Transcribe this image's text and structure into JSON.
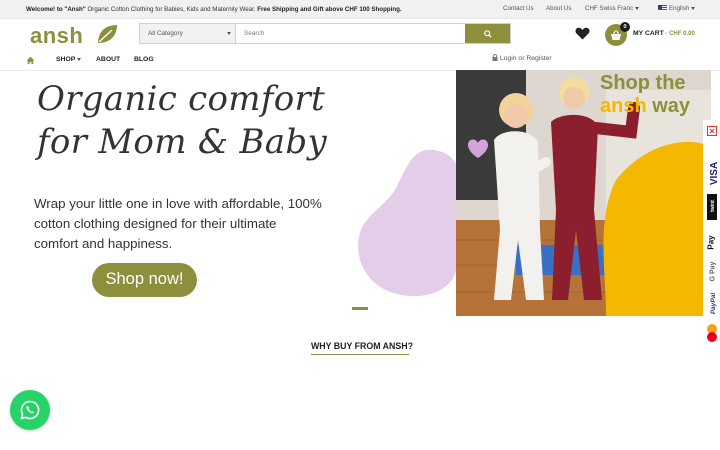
{
  "topbar": {
    "welcome_bold": "Welcome! to \"Ansh\"",
    "welcome_text": " Organic Cotton Clothing for Babies, Kids and Maternity Wear.",
    "shipping": " Free Shipping and Gift above CHF 100 Shopping.",
    "contact": "Contact Us",
    "about": "About Us",
    "currency": "CHF Swiss Franc",
    "language": "English"
  },
  "header": {
    "logo": "ansh",
    "category": "All Category",
    "search_placeholder": "Search",
    "cart_count": "0",
    "cart_label": "MY CART",
    "cart_amount": " · CHF 0.00"
  },
  "nav": {
    "shop": "SHOP",
    "about": "ABOUT",
    "blog": "BLOG",
    "login": "Login or Register"
  },
  "hero": {
    "title_line1": "Organic comfort",
    "title_line2": "for Mom & Baby",
    "subtitle": "Wrap your little one in love with affordable, 100% cotton clothing designed for their ultimate comfort and happiness.",
    "cta": "Shop now!",
    "overlay_line1": "Shop the",
    "overlay_ansh": "ansh",
    "overlay_way": " way"
  },
  "payments": [
    "VISA",
    "twint",
    "Pay",
    "G Pay",
    "PayPal"
  ],
  "section": {
    "why_title": "WHY BUY FROM ANSH?"
  },
  "colors": {
    "brand_olive": "#8d8f3c",
    "accent_yellow": "#f5b800",
    "blob_lavender": "#e3cde9",
    "whatsapp_green": "#25d366"
  }
}
